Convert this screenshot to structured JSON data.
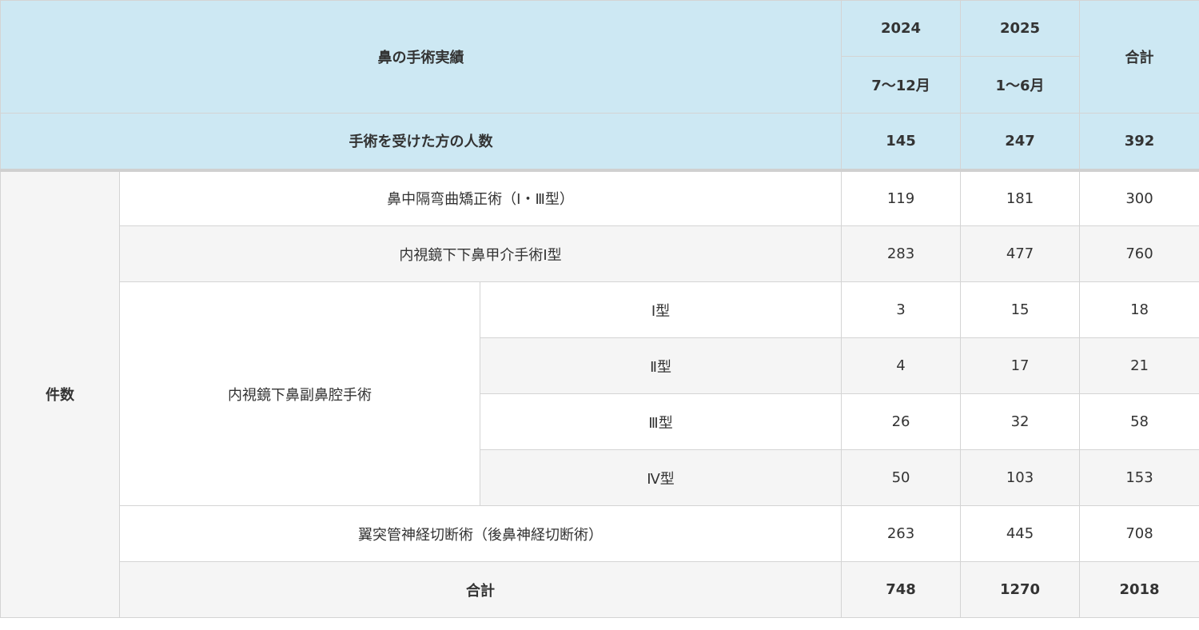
{
  "header": {
    "title": "鼻の手術実績",
    "year_2024": "2024",
    "year_2025": "2025",
    "period_2024": "7〜12月",
    "period_2025": "1〜6月",
    "total_label": "合計"
  },
  "patients": {
    "label": "手術を受けた方の人数",
    "v2024": "145",
    "v2025": "247",
    "total": "392"
  },
  "group_label": "件数",
  "rows": [
    {
      "label": "鼻中隔弯曲矯正術（Ⅰ・Ⅲ型）",
      "v2024": "119",
      "v2025": "181",
      "total": "300"
    },
    {
      "label": "内視鏡下下鼻甲介手術Ⅰ型",
      "v2024": "283",
      "v2025": "477",
      "total": "760"
    }
  ],
  "sinus": {
    "label": "内視鏡下鼻副鼻腔手術",
    "types": [
      {
        "label": "Ⅰ型",
        "v2024": "3",
        "v2025": "15",
        "total": "18"
      },
      {
        "label": "Ⅱ型",
        "v2024": "4",
        "v2025": "17",
        "total": "21"
      },
      {
        "label": "Ⅲ型",
        "v2024": "26",
        "v2025": "32",
        "total": "58"
      },
      {
        "label": "Ⅳ型",
        "v2024": "50",
        "v2025": "103",
        "total": "153"
      }
    ]
  },
  "vidian": {
    "label": "翼突管神経切断術（後鼻神経切断術）",
    "v2024": "263",
    "v2025": "445",
    "total": "708"
  },
  "sum": {
    "label": "合計",
    "v2024": "748",
    "v2025": "1270",
    "total": "2018"
  },
  "colors": {
    "header_bg": "#cde8f3",
    "row_gray": "#f5f5f5",
    "border": "#d4d4d4"
  }
}
